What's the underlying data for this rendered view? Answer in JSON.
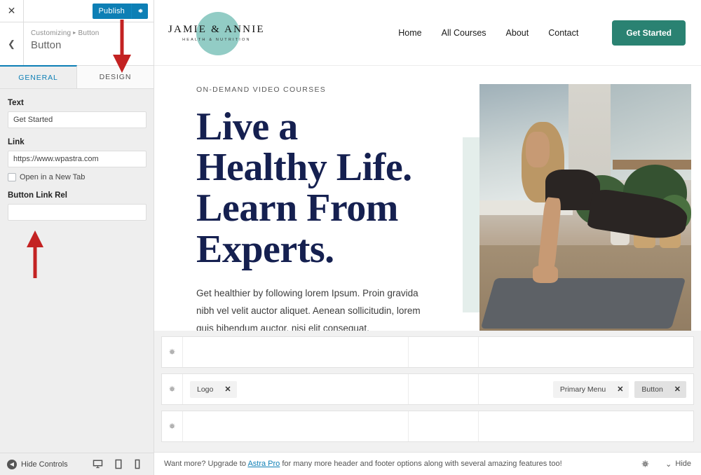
{
  "customizer": {
    "close_icon": "close-icon",
    "publish_label": "Publish",
    "publish_gear_icon": "gear-icon",
    "back_icon": "chevron-left-icon",
    "breadcrumb_root": "Customizing",
    "breadcrumb_sep": "▸",
    "breadcrumb_current": "Button",
    "panel_title": "Button",
    "tabs": [
      {
        "label": "GENERAL",
        "active": true
      },
      {
        "label": "DESIGN",
        "active": false
      }
    ],
    "fields": {
      "text_label": "Text",
      "text_value": "Get Started",
      "link_label": "Link",
      "link_value": "https://www.wpastra.com",
      "new_tab_label": "Open in a New Tab",
      "new_tab_checked": false,
      "rel_label": "Button Link Rel",
      "rel_value": "",
      "rel_placeholder": ""
    },
    "footer": {
      "hide_controls_label": "Hide Controls",
      "hide_icon": "collapse-left-icon",
      "devices": [
        "desktop-icon",
        "tablet-icon",
        "mobile-icon"
      ]
    }
  },
  "annotations": {
    "arrow_color": "#d32121",
    "arrow_to_design_tab": "arrow-down-to-design-tab",
    "arrow_to_link_rel": "arrow-up-to-button-link-rel"
  },
  "site": {
    "logo": {
      "name": "JAMIE & ANNIE",
      "tagline": "HEALTH & NUTRITION",
      "circle_color": "#8cc9c2"
    },
    "nav": [
      "Home",
      "All Courses",
      "About",
      "Contact"
    ],
    "nav_cta": "Get Started",
    "hero": {
      "eyebrow": "ON-DEMAND VIDEO COURSES",
      "heading_lines": [
        "Live a",
        "Healthy Life.",
        "Learn From",
        "Experts."
      ],
      "paragraph": "Get healthier by following lorem Ipsum. Proin gravida nibh vel velit auctor aliquet. Aenean sollicitudin, lorem quis bibendum auctor, nisi elit consequat.",
      "image_alt": "woman-doing-yoga-lunge-in-plant-filled-studio"
    },
    "colors": {
      "accent_teal": "#2a8272",
      "heading_navy": "#152050",
      "mint": "#e4eeeb"
    }
  },
  "builder": {
    "gear_icon": "gear-icon",
    "rows": [
      {
        "name": "above-header-row",
        "left": [],
        "center": [],
        "right": []
      },
      {
        "name": "primary-header-row",
        "left": [
          {
            "label": "Logo",
            "selected": false
          }
        ],
        "center": [],
        "right": [
          {
            "label": "Primary Menu",
            "selected": false
          },
          {
            "label": "Button",
            "selected": true
          }
        ]
      },
      {
        "name": "below-header-row",
        "left": [],
        "center": [],
        "right": []
      }
    ],
    "close_chip_icon": "close-icon"
  },
  "promo": {
    "text_before": "Want more? Upgrade to ",
    "link": "Astra Pro",
    "text_after": " for many more header and footer options along with several amazing features too!",
    "gear_icon": "gear-icon",
    "hide_label": "Hide",
    "hide_icon": "chevron-down-icon"
  }
}
